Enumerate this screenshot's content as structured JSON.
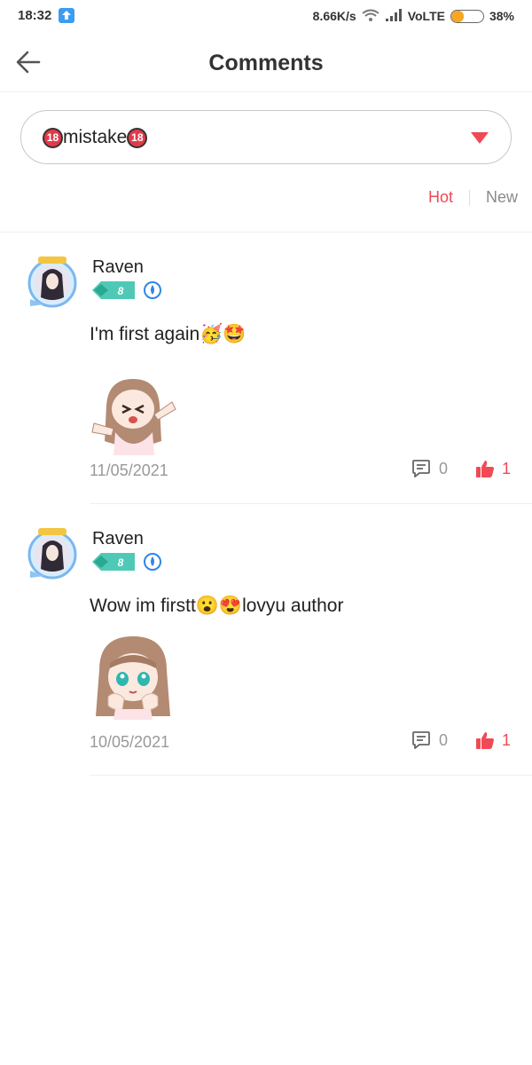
{
  "status_bar": {
    "time": "18:32",
    "speed": "8.66K/s",
    "network": "VoLTE",
    "battery_text": "38%",
    "battery_level": 0.38
  },
  "header": {
    "title": "Comments",
    "back_icon": "arrow-left-icon"
  },
  "chapter_select": {
    "badge": "18",
    "label": "mistake",
    "arrow_icon": "triangle-down-icon",
    "accent": "#f04a55"
  },
  "sort": {
    "hot": "Hot",
    "new": "New",
    "active": "Hot"
  },
  "comments": [
    {
      "username": "Raven",
      "level": "8",
      "text": "I'm first again🥳🤩",
      "sticker": "girl-stretching-sticker",
      "date": "11/05/2021",
      "replies": "0",
      "likes": "1"
    },
    {
      "username": "Raven",
      "level": "8",
      "text": "Wow im firstt😮😍lovyu author",
      "sticker": "girl-cheeks-sticker",
      "date": "10/05/2021",
      "replies": "0",
      "likes": "1"
    }
  ]
}
